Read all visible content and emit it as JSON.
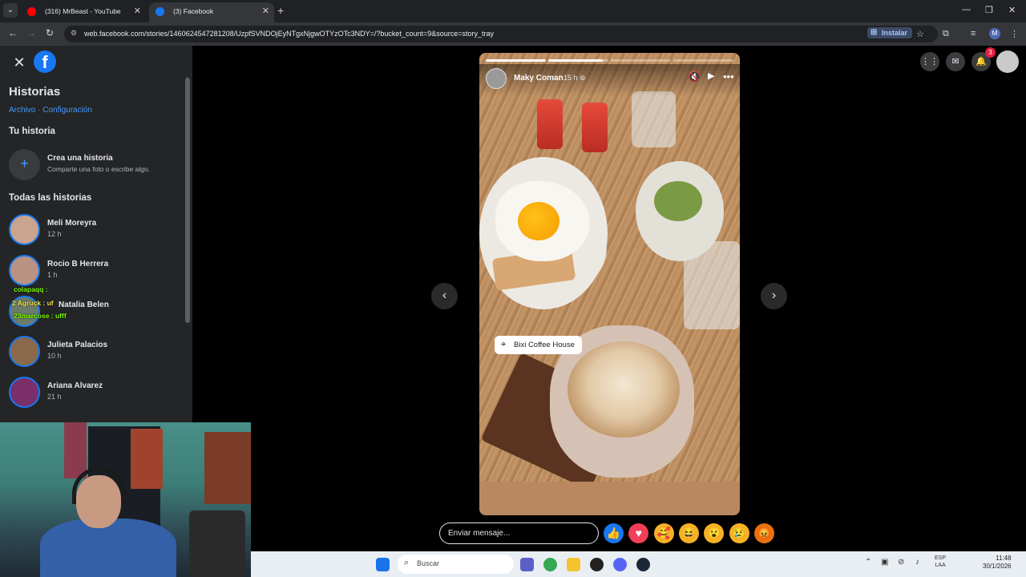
{
  "browser": {
    "tabs": [
      {
        "title": "(316) MrBeast - YouTube",
        "favicon_color": "#ff0000"
      },
      {
        "title": "(3) Facebook",
        "favicon_color": "#1877f2"
      }
    ],
    "url": "web.facebook.com/stories/1460624547281208/UzpfSVNDOjEyNTgxNjgwOTYzOTc3NDY=/?bucket_count=9&source=story_tray",
    "install_label": "Instalar",
    "profile_initial": "M"
  },
  "sidebar": {
    "title": "Historias",
    "links": "Archivo · Configuración",
    "your_story_heading": "Tu historia",
    "create": {
      "title": "Crea una historia",
      "subtitle": "Comparte una foto o escribe algo."
    },
    "all_stories_heading": "Todas las historias",
    "stories": [
      {
        "name": "Meli Moreyra",
        "time": "12 h"
      },
      {
        "name": "Rocio B Herrera",
        "time": "1 h"
      },
      {
        "name": "Natalia Belen",
        "time": ""
      },
      {
        "name": "Julieta Palacios",
        "time": "10 h"
      },
      {
        "name": "Ariana Alvarez",
        "time": "21 h"
      }
    ]
  },
  "chat_overlay": [
    {
      "user": "colapaqq :",
      "color": "#7cfc00"
    },
    {
      "user": "2 Agruck : uf",
      "color": "#f5e642"
    },
    {
      "user": "23marcose : ufff",
      "color": "#7cfc00"
    }
  ],
  "story": {
    "author": "Maky Coman",
    "time": "15 h",
    "location": "Bixi Coffee House",
    "progress_segments": 4,
    "progress_completed": 1,
    "progress_current_fraction": 0.9
  },
  "notifications_count": "3",
  "reply": {
    "placeholder": "Enviar mensaje..."
  },
  "reactions": [
    {
      "name": "like",
      "glyph": "👍",
      "color": "#1877f2"
    },
    {
      "name": "love",
      "glyph": "♥",
      "color": "#f33e58"
    },
    {
      "name": "care",
      "glyph": "🥰",
      "color": "#f7b125"
    },
    {
      "name": "haha",
      "glyph": "😆",
      "color": "#f7b125"
    },
    {
      "name": "wow",
      "glyph": "😮",
      "color": "#f7b125"
    },
    {
      "name": "sad",
      "glyph": "😢",
      "color": "#f7b125"
    },
    {
      "name": "angry",
      "glyph": "😡",
      "color": "#e9710f"
    }
  ],
  "taskbar": {
    "search_placeholder": "Buscar",
    "lang_line1": "ESP",
    "lang_line2": "LAA",
    "time": "11:48",
    "date": "30/1/2026"
  }
}
